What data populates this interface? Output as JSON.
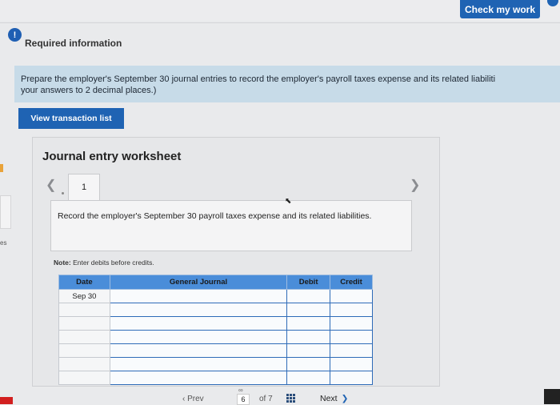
{
  "header": {
    "check_label": "Check my work"
  },
  "required": {
    "icon_text": "!",
    "title": "Required information"
  },
  "instructions": {
    "line1": "Prepare the employer's September 30 journal entries to record the employer's payroll taxes expense and its related liabiliti",
    "line2": "your answers to 2 decimal places.)"
  },
  "view_button": "View transaction list",
  "sidebar": {
    "tag": "es"
  },
  "worksheet": {
    "title": "Journal entry worksheet",
    "tab_number": "1",
    "record_text": "Record the employer's September 30 payroll taxes expense and its related liabilities.",
    "note_label": "Note:",
    "note_text": "Enter debits before credits."
  },
  "table": {
    "headers": [
      "Date",
      "General Journal",
      "Debit",
      "Credit"
    ],
    "rows": [
      [
        "Sep 30",
        "",
        "",
        ""
      ],
      [
        "",
        "",
        "",
        ""
      ],
      [
        "",
        "",
        "",
        ""
      ],
      [
        "",
        "",
        "",
        ""
      ],
      [
        "",
        "",
        "",
        ""
      ],
      [
        "",
        "",
        "",
        ""
      ],
      [
        "",
        "",
        "",
        ""
      ]
    ]
  },
  "pagination": {
    "prev_label": "Prev",
    "page": "6",
    "of_text": "of 7",
    "next_label": "Next",
    "link_glyph": "∞"
  },
  "icons": {
    "left_arrow": "chevron-left-icon",
    "right_arrow": "chevron-right-icon",
    "grid": "grid-icon",
    "next": "chevron-right-icon"
  },
  "colors": {
    "primary": "#1f63b3",
    "instruction_bg": "#c7dbe8",
    "table_header": "#4a8dd9"
  }
}
